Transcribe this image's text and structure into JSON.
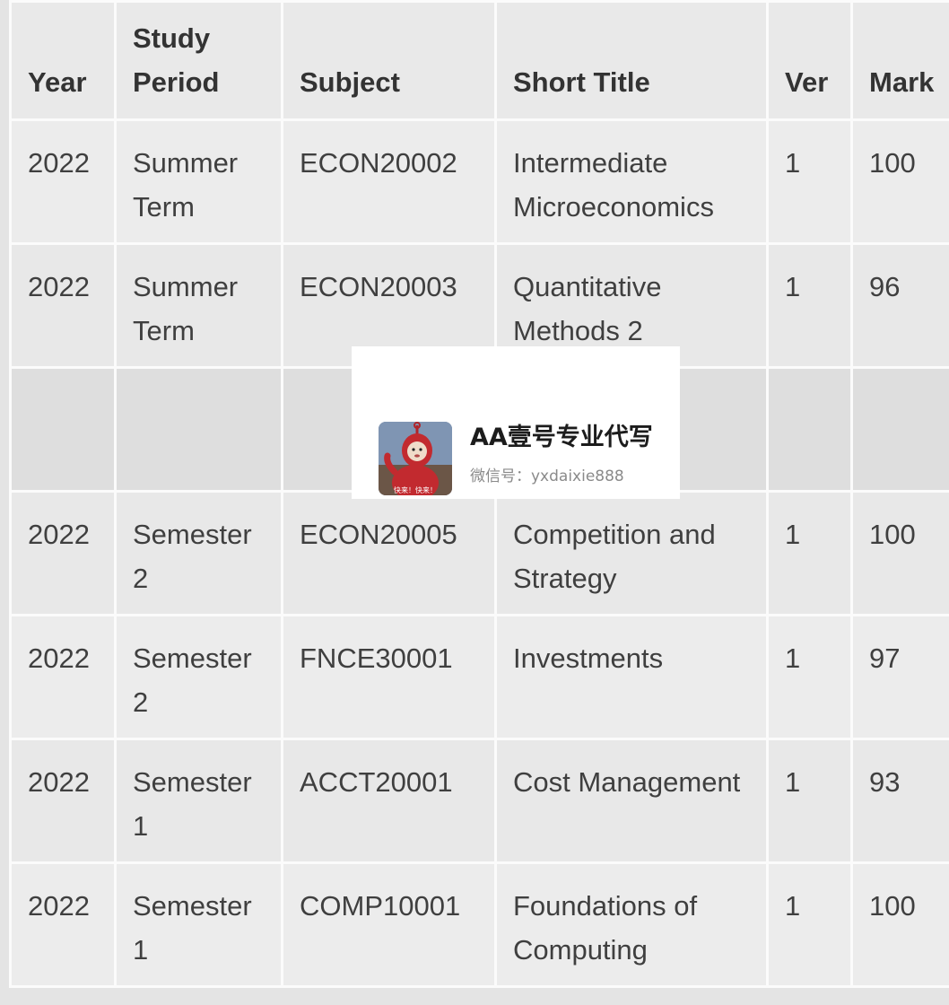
{
  "table": {
    "headers": {
      "year": "Year",
      "study_period": "Study Period",
      "subject": "Subject",
      "short_title": "Short Title",
      "ver": "Ver",
      "mark": "Mark"
    },
    "rows": [
      {
        "year": "2022",
        "study_period": "Summer Term",
        "subject": "ECON20002",
        "short_title": "Intermediate Microeconomics",
        "ver": "1",
        "mark": "100"
      },
      {
        "year": "2022",
        "study_period": "Summer Term",
        "subject": "ECON20003",
        "short_title": "Quantitative Methods 2",
        "ver": "1",
        "mark": "96"
      },
      {
        "year": "",
        "study_period": "",
        "subject": "",
        "short_title": "",
        "ver": "",
        "mark": ""
      },
      {
        "year": "2022",
        "study_period": "Semester 2",
        "subject": "ECON20005",
        "short_title": "Competition and Strategy",
        "ver": "1",
        "mark": "100"
      },
      {
        "year": "2022",
        "study_period": "Semester 2",
        "subject": "FNCE30001",
        "short_title": "Investments",
        "ver": "1",
        "mark": "97"
      },
      {
        "year": "2022",
        "study_period": "Semester 1",
        "subject": "ACCT20001",
        "short_title": "Cost Management",
        "ver": "1",
        "mark": "93"
      },
      {
        "year": "2022",
        "study_period": "Semester 1",
        "subject": "COMP10001",
        "short_title": "Foundations of Computing",
        "ver": "1",
        "mark": "100"
      }
    ]
  },
  "watermark": {
    "title": "AA壹号专业代写",
    "subtitle": "微信号：yxdaixie888",
    "avatar_icon": "teletubby-avatar-icon",
    "avatar_caption": "快来！快来！"
  }
}
